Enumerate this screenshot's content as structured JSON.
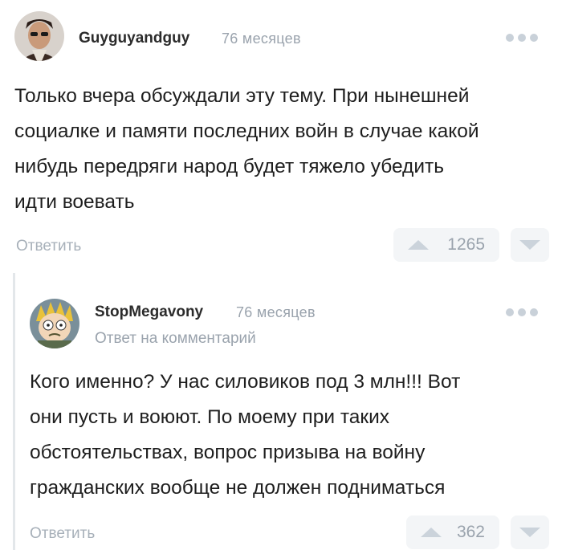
{
  "comment1": {
    "username": "Guyguyandguy",
    "time": "76 месяцев",
    "text_lines": [
      "Только вчера обсуждали эту тему. При нынешней",
      "социалке и памяти последних войн в случае какой",
      "нибудь передряги народ будет тяжело убедить",
      "идти воевать"
    ],
    "reply_label": "Ответить",
    "rating": "1265"
  },
  "comment2": {
    "username": "StopMegavony",
    "time": "76 месяцев",
    "reply_to_prefix": "Ответ на",
    "reply_to_link": "комментарий",
    "text_lines": [
      "Кого именно? У нас силовиков под 3 млн!!! Вот",
      "они пусть и воюют. По моему при таких",
      "обстоятельствах, вопрос призыва на войну",
      "гражданских вообще не должен подниматься"
    ],
    "reply_label": "Ответить",
    "rating": "362"
  },
  "colors": {
    "muted": "#9aa3ad",
    "vote_bg": "#f3f5f7",
    "vote_arrow": "#cbd3db",
    "thread_line": "#e3e7ea"
  }
}
